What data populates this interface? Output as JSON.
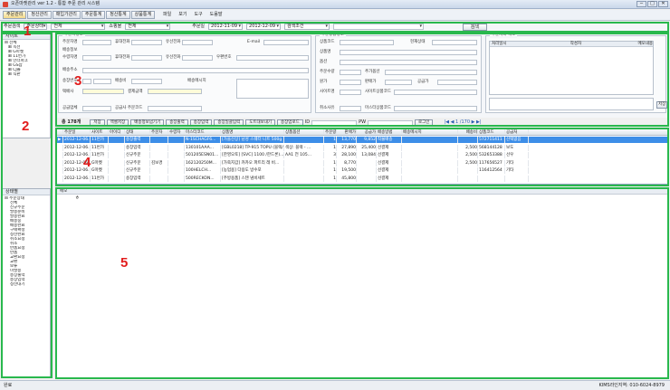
{
  "window": {
    "title": "오픈마켓관리 ver 1.2 - 통합 주문 관리 시스템",
    "controls": [
      "─",
      "□",
      "✕"
    ]
  },
  "menubar": {
    "buttons": [
      "주문관리",
      "정산관리",
      "매입가관리",
      "주문통계",
      "정산통계",
      "상품통계"
    ],
    "items": [
      "파일",
      "보기",
      "도구",
      "도움말"
    ]
  },
  "filter": {
    "order_label": "주문검색",
    "order_value": "주문상태",
    "status_value": "전체",
    "market_label": "쇼핑몰",
    "market_value": "전체",
    "date_label": "주문일",
    "date_from": "2012-11-09",
    "date_to": "2012-12-09",
    "keyword_placeholder": "검색조건",
    "search_button": "검색"
  },
  "sidebar": {
    "title": "사이트",
    "items": [
      "전체",
      "옥션",
      "G마켓",
      "11번가",
      "인터파크",
      "GS샵",
      "CJ몰",
      "직판"
    ],
    "section2_title": "상태별",
    "statuses": [
      "주문상태",
      "전체",
      "신규주문",
      "발송준비",
      "발송완료",
      "배송중",
      "배송완료",
      "구매확정",
      "정산완료",
      "취소요청",
      "취소",
      "반품요청",
      "반품",
      "교환요청",
      "교환",
      "보류",
      "미발송",
      "송장출력",
      "송장입력",
      "정산대기"
    ]
  },
  "form": {
    "order_group": "주문자정보",
    "product_group": "주문상품정보",
    "memo_group": "주문처리 메모",
    "labels": {
      "orderer": "주문자명",
      "phone1": "휴대전화",
      "phone2": "유선전화",
      "email": "E-mail",
      "recipient_head": "배송정보",
      "recipient": "수령자명",
      "rphone1": "휴대전화",
      "rphone2": "유선전화",
      "zipcode": "우편번호",
      "address": "배송주소",
      "invoice": "송장번호",
      "courier": "택배사",
      "invoice_msg": "배송메시지",
      "fee": "배송비",
      "payment": "결제금액",
      "supplier": "공급업체",
      "supplier_code": "공급사 주문코드",
      "product_code": "상품코드",
      "status": "현재상태",
      "product_name": "상품명",
      "option": "옵션",
      "qty": "주문수량",
      "added_option": "추가옵션",
      "price": "원가",
      "sale_price": "판매가",
      "supply_price": "공급가",
      "site": "사이트명",
      "site_code": "사이트상품코드",
      "cancel_reason": "취소사유",
      "market_code": "마스터상품코드",
      "memo_date": "처리일시",
      "memo_user": "작성자",
      "memo_text": "메모내용",
      "memo_save": "저장"
    }
  },
  "actions": {
    "count": "총 178개",
    "buttons": [
      "저장",
      "엑셀저장",
      "배송정보넘기기",
      "송장출력",
      "송장입력",
      "송장일괄입력",
      "도트대보내기",
      "송장업로드"
    ],
    "id_label": "ID",
    "pw_label": "PW",
    "login": "로그인",
    "pager": "|◀ ◀ 1 /170 ▶ ▶|"
  },
  "grid": {
    "columns": [
      "",
      "주문일",
      "사이트",
      "아이디",
      "상태",
      "주문자",
      "수령자",
      "마스터코드",
      "상품명",
      "상품옵션",
      "주문량",
      "판매가",
      "공급가",
      "배송방법",
      "배송메시지",
      "배송비",
      "상품코드",
      "공급처"
    ],
    "rows": [
      [
        "▶",
        "2012-12-06...",
        "11번가",
        "",
        "송장출력",
        "",
        "",
        "N-1SCHAGF6...",
        "[가을신상] 남성 스웨터 니트 500g",
        "",
        "1",
        "13,770",
        "9,852",
        "착불배송",
        "",
        "",
        "572711411",
        "선택없음"
      ],
      [
        "",
        "2012-12-06...",
        "11번가",
        "",
        "송장입력",
        "",
        "",
        "130101AAA...",
        "[GBL0218] TP-915 TOPU (블랙/...",
        "색상: 블랙 - ...",
        "1",
        "27,890",
        "25,400",
        "선결제",
        "",
        "2,500",
        "568144128",
        "보도"
      ],
      [
        "",
        "2012-12-06...",
        "11번가",
        "",
        "신규주문",
        "",
        "",
        "501205ESN01...",
        "[한영오토] [SVC] 1100 /한드론)...",
        "AA1 전 105...",
        "3",
        "28,100",
        "13,084",
        "선결제",
        "",
        "2,500",
        "532653388",
        "선우"
      ],
      [
        "",
        "2012-12-06...",
        "G마켓",
        "",
        "신규주문",
        "김보경",
        "",
        "162120250M...",
        "[가죽지갑] 카카오 파트리 레 비...",
        "",
        "1",
        "8,770",
        "",
        "선결제",
        "",
        "2,500",
        "117656527",
        "기타"
      ],
      [
        "",
        "2012-12-06...",
        "G마켓",
        "",
        "신규주문",
        "",
        "",
        "100HELCH...",
        "[농업용] 다용도 방수포",
        "",
        "1",
        "19,500",
        "",
        "선결제",
        "",
        "",
        "116412564",
        "기타"
      ],
      [
        "",
        "2012-12-06...",
        "11번가",
        "",
        "송장입력",
        "",
        "",
        "500RECKON...",
        "[주방용품] 스텐 냄비세트",
        "",
        "1",
        "45,800",
        "",
        "선결제",
        "",
        "",
        "",
        ""
      ]
    ]
  },
  "detail": {
    "header": "메모",
    "prefix": "ㅎ"
  },
  "statusbar": {
    "left": "완료",
    "right": "KIMS라인지역: 010-6024-8979"
  },
  "annotations": {
    "n1": "1",
    "n2": "2",
    "n3": "3",
    "n4": "4",
    "n5": "5"
  },
  "colors": {
    "highlight": "#29b84d",
    "number": "#e21c1c",
    "selected_row": "#3d8ee8"
  }
}
